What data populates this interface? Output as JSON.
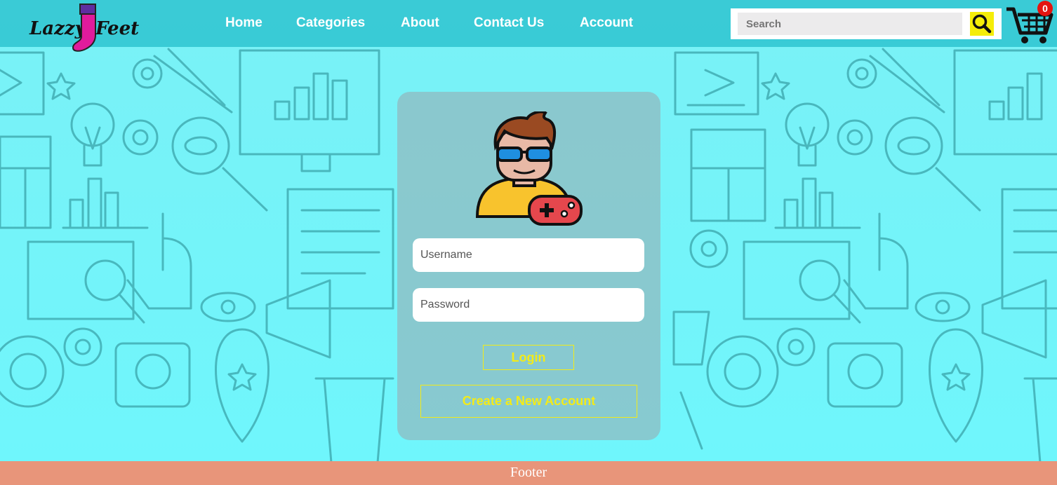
{
  "brand": {
    "left": "Lazzy",
    "right": "Feet",
    "accent_color": "#c0169a"
  },
  "nav": {
    "items": [
      "Home",
      "Categories",
      "About",
      "Contact Us",
      "Account"
    ]
  },
  "search": {
    "placeholder": "Search",
    "value": "",
    "button_icon": "search-icon"
  },
  "cart": {
    "count": "0",
    "icon": "cart-icon"
  },
  "login": {
    "avatar_icon": "gamer-avatar-icon",
    "username_placeholder": "Username",
    "password_placeholder": "Password",
    "login_label": "Login",
    "create_label": "Create a New Account"
  },
  "footer": {
    "text": "Footer"
  },
  "colors": {
    "header": "#34c8d2",
    "background": "#72f7fb",
    "search_button": "#f5ed08",
    "button_text": "#f3eb18",
    "footer": "#e8957a",
    "badge": "#e3140f"
  }
}
